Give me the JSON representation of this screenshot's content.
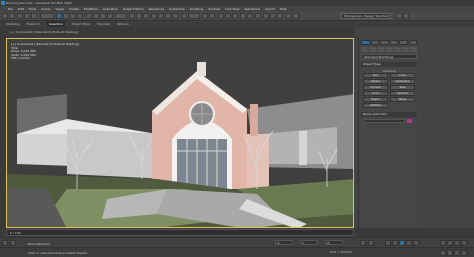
{
  "window": {
    "title": "Ground_plan.max - Autodesk 3ds Max 2022"
  },
  "menu": [
    "File",
    "Edit",
    "Tools",
    "Group",
    "Views",
    "Create",
    "Modifiers",
    "Animation",
    "Graph Editors",
    "Rendering",
    "Customize",
    "Scripting",
    "Content",
    "Civil View",
    "Substance",
    "Arnold",
    "Help"
  ],
  "toolbar": {
    "workspace": "Workspaces: Design Standard"
  },
  "ribbon": {
    "tabs": [
      "Modeling",
      "Freeform",
      "Selection",
      "Object Paint",
      "Populate",
      "Options"
    ],
    "selected_index": 2
  },
  "viewport": {
    "header": "[+] [Camera01] [Standard] [Default Shading]",
    "label": "[+] [Camera01] [Standard] [Default Shading]",
    "stats_title": "Total",
    "polys": "Polys: 2,041,366",
    "verts": "Verts: 2,030,583",
    "fps": "FPS: Inactive"
  },
  "command_panel": {
    "dropdown": "Standard Primitives",
    "object_type_title": "Object Type",
    "autogrid": "AutoGrid",
    "objects": [
      "Box",
      "Cone",
      "Sphere",
      "GeoSphere",
      "Cylinder",
      "Tube",
      "Torus",
      "Pyramid",
      "Teapot",
      "Plane",
      "TextPlus",
      ""
    ],
    "name_color_title": "Name and Color",
    "swatch_color": "#c02ea0"
  },
  "timeline": {
    "frame": "0 / 100"
  },
  "status": {
    "line1": "None Selected",
    "line2": "Click or click-and-drag to select objects",
    "x": "X:",
    "y": "Y:",
    "z": "Z:",
    "grid": "Grid = 10.0cm"
  },
  "colors": {
    "accent": "#2b6fa3",
    "viewport_border": "#e1c05a"
  }
}
